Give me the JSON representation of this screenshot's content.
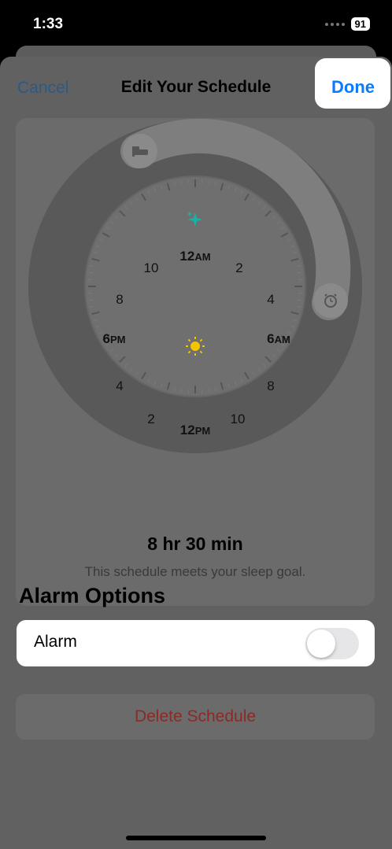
{
  "status_bar": {
    "time": "1:33",
    "battery": "91"
  },
  "nav": {
    "cancel": "Cancel",
    "title": "Edit Your Schedule",
    "done": "Done"
  },
  "clock": {
    "labels": {
      "top": "12",
      "top_suffix": "AM",
      "right": "6",
      "right_suffix": "AM",
      "bottom": "12",
      "bottom_suffix": "PM",
      "left": "6",
      "left_suffix": "PM",
      "n2_tr": "2",
      "n4_tr": "4",
      "n8_br": "8",
      "n10_br": "10",
      "n2_bl": "2",
      "n4_bl": "4",
      "n8_tl": "8",
      "n10_tl": "10"
    },
    "bedtime_icon": "bed-icon",
    "wake_icon": "alarm-clock-icon",
    "midnight_icon": "sparkle-icon",
    "noon_icon": "sun-icon",
    "colors": {
      "sparkle": "#14b3a6",
      "sun": "#f5c400"
    }
  },
  "summary": {
    "duration": "8 hr 30 min",
    "goal_text": "This schedule meets your sleep goal."
  },
  "alarm_options": {
    "header": "Alarm Options",
    "alarm_label": "Alarm",
    "alarm_on": false
  },
  "delete": {
    "label": "Delete Schedule"
  }
}
